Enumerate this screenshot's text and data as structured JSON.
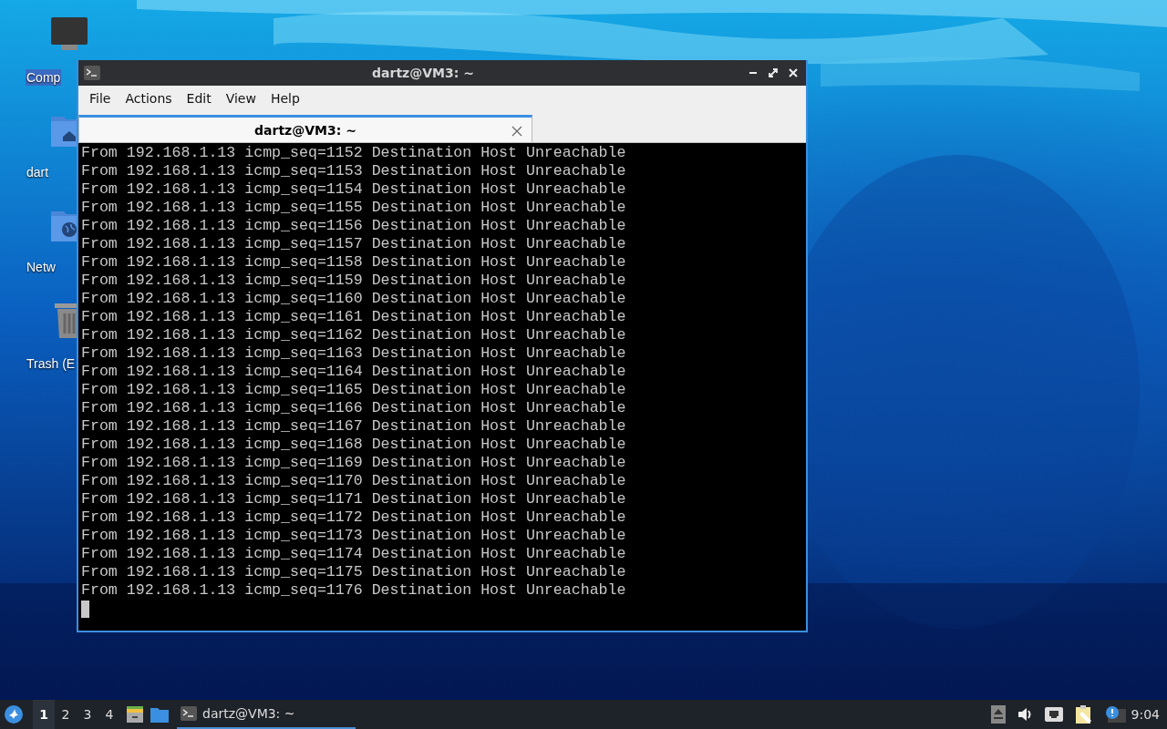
{
  "desktop_icons": [
    {
      "kind": "computer",
      "label": "Comp",
      "selected": true
    },
    {
      "kind": "home",
      "label": "dart",
      "selected": false
    },
    {
      "kind": "network",
      "label": "Netw",
      "selected": false
    },
    {
      "kind": "trash",
      "label": "Trash (E",
      "selected": false
    }
  ],
  "window": {
    "title": "dartz@VM3: ~",
    "menu": [
      "File",
      "Actions",
      "Edit",
      "View",
      "Help"
    ],
    "tabs": [
      {
        "label": "dartz@VM3: ~",
        "selected": true
      }
    ],
    "terminal": {
      "cursor": true,
      "lines": [
        "From 192.168.1.13 icmp_seq=1152 Destination Host Unreachable",
        "From 192.168.1.13 icmp_seq=1153 Destination Host Unreachable",
        "From 192.168.1.13 icmp_seq=1154 Destination Host Unreachable",
        "From 192.168.1.13 icmp_seq=1155 Destination Host Unreachable",
        "From 192.168.1.13 icmp_seq=1156 Destination Host Unreachable",
        "From 192.168.1.13 icmp_seq=1157 Destination Host Unreachable",
        "From 192.168.1.13 icmp_seq=1158 Destination Host Unreachable",
        "From 192.168.1.13 icmp_seq=1159 Destination Host Unreachable",
        "From 192.168.1.13 icmp_seq=1160 Destination Host Unreachable",
        "From 192.168.1.13 icmp_seq=1161 Destination Host Unreachable",
        "From 192.168.1.13 icmp_seq=1162 Destination Host Unreachable",
        "From 192.168.1.13 icmp_seq=1163 Destination Host Unreachable",
        "From 192.168.1.13 icmp_seq=1164 Destination Host Unreachable",
        "From 192.168.1.13 icmp_seq=1165 Destination Host Unreachable",
        "From 192.168.1.13 icmp_seq=1166 Destination Host Unreachable",
        "From 192.168.1.13 icmp_seq=1167 Destination Host Unreachable",
        "From 192.168.1.13 icmp_seq=1168 Destination Host Unreachable",
        "From 192.168.1.13 icmp_seq=1169 Destination Host Unreachable",
        "From 192.168.1.13 icmp_seq=1170 Destination Host Unreachable",
        "From 192.168.1.13 icmp_seq=1171 Destination Host Unreachable",
        "From 192.168.1.13 icmp_seq=1172 Destination Host Unreachable",
        "From 192.168.1.13 icmp_seq=1173 Destination Host Unreachable",
        "From 192.168.1.13 icmp_seq=1174 Destination Host Unreachable",
        "From 192.168.1.13 icmp_seq=1175 Destination Host Unreachable",
        "From 192.168.1.13 icmp_seq=1176 Destination Host Unreachable"
      ]
    }
  },
  "taskbar": {
    "workspaces": [
      {
        "label": "1",
        "selected": true
      },
      {
        "label": "2",
        "selected": false
      },
      {
        "label": "3",
        "selected": false
      },
      {
        "label": "4",
        "selected": false
      }
    ],
    "tasks": [
      {
        "label": "dartz@VM3: ~",
        "selected": true
      }
    ],
    "clock": "9:04"
  }
}
